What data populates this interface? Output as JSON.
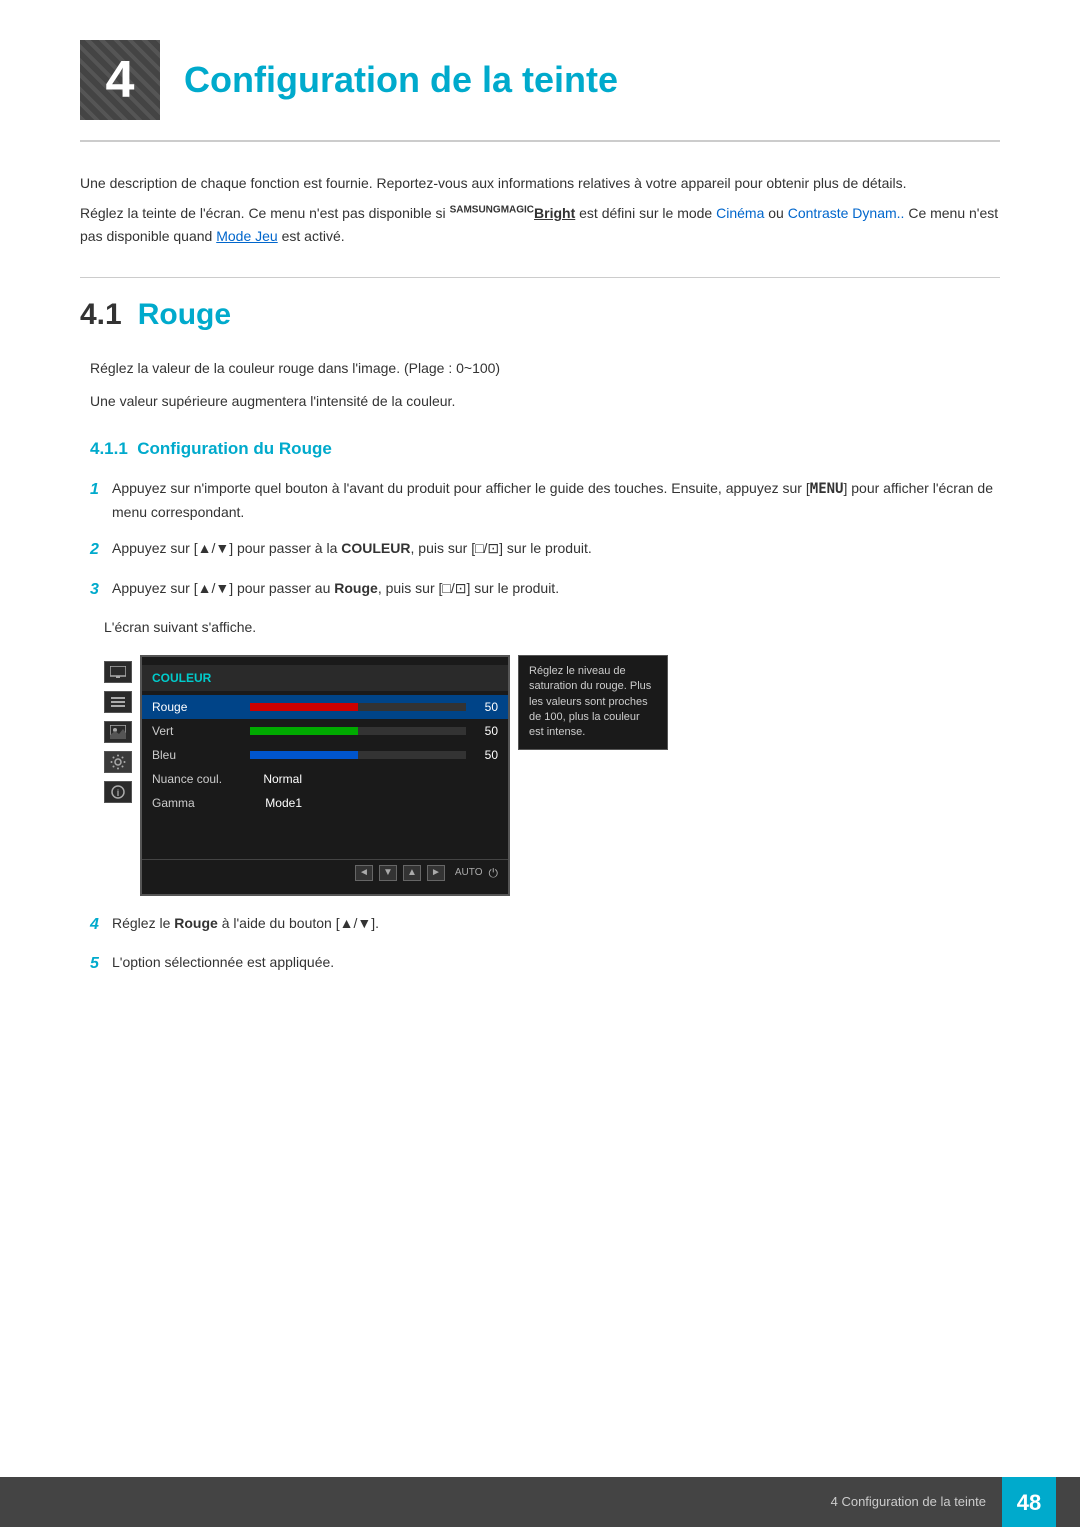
{
  "chapter": {
    "number": "4",
    "title": "Configuration de la teinte"
  },
  "intro": {
    "line1": "Une description de chaque fonction est fournie. Reportez-vous aux informations relatives à votre appareil pour obtenir plus de détails.",
    "line2_prefix": "Réglez la teinte de l'écran. Ce menu n'est pas disponible si ",
    "magic_super": "SAMSUNG",
    "magic_brand": "MAGIC",
    "magic_bright": "Bright",
    "line2_mid": " est défini sur le mode ",
    "cinema": "Cinéma",
    "line2_or": " ou ",
    "contraste": "Contraste Dynam..",
    "line2_end": " Ce menu n'est pas disponible quand ",
    "mode_jeu": "Mode Jeu",
    "line2_final": " est activé."
  },
  "section41": {
    "number": "4.1",
    "title": "Rouge",
    "body1": "Réglez la valeur de la couleur rouge dans l'image. (Plage : 0~100)",
    "body2": "Une valeur supérieure augmentera l'intensité de la couleur."
  },
  "subsection411": {
    "number": "4.1.1",
    "title": "Configuration du Rouge"
  },
  "steps": {
    "step1": {
      "num": "1",
      "text_prefix": "Appuyez sur n'importe quel bouton à l'avant du produit pour afficher le guide des touches. Ensuite, appuyez sur [",
      "menu_kbd": "MENU",
      "text_suffix": "] pour afficher l'écran de menu correspondant."
    },
    "step2": {
      "num": "2",
      "text_prefix": "Appuyez sur [▲/▼] pour passer à la ",
      "couleur": "COULEUR",
      "text_suffix": ", puis sur [□/⊡] sur le produit."
    },
    "step3": {
      "num": "3",
      "text_prefix": "Appuyez sur [▲/▼] pour passer au ",
      "rouge": "Rouge",
      "text_suffix": ", puis sur [□/⊡] sur le produit.",
      "sub_text": "L'écran suivant s'affiche."
    },
    "step4": {
      "num": "4",
      "text_prefix": "Réglez le ",
      "rouge": "Rouge",
      "text_suffix": " à l'aide du bouton [▲/▼]."
    },
    "step5": {
      "num": "5",
      "text": "L'option sélectionnée est appliquée."
    }
  },
  "screen": {
    "header": "COULEUR",
    "rows": [
      {
        "label": "Rouge",
        "type": "bar",
        "bar": "red",
        "value": "50"
      },
      {
        "label": "Vert",
        "type": "bar",
        "bar": "green",
        "value": "50"
      },
      {
        "label": "Bleu",
        "type": "bar",
        "bar": "blue",
        "value": "50"
      },
      {
        "label": "Nuance coul.",
        "type": "text",
        "value": "Normal"
      },
      {
        "label": "Gamma",
        "type": "text",
        "value": "Mode1"
      }
    ],
    "nav_buttons": [
      "◄",
      "▼",
      "▲",
      "►"
    ],
    "auto_label": "AUTO",
    "tooltip": "Réglez le niveau de saturation du rouge. Plus les valeurs sont proches de 100, plus la couleur est intense."
  },
  "footer": {
    "text": "4 Configuration de la teinte",
    "page": "48"
  }
}
